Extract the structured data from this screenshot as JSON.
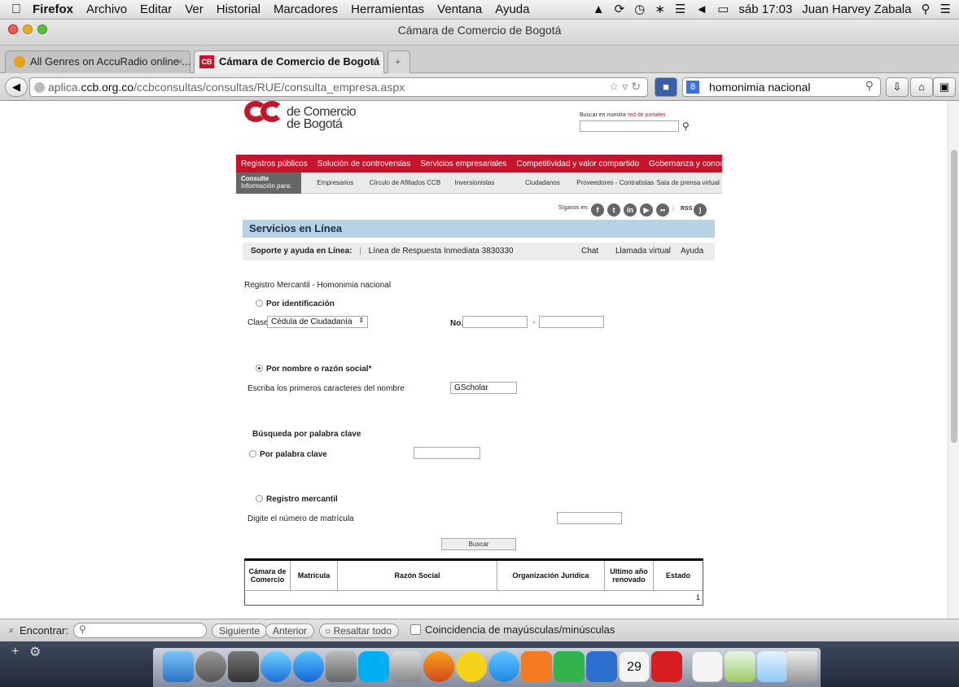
{
  "menubar": {
    "app": "Firefox",
    "items": [
      "Archivo",
      "Editar",
      "Ver",
      "Historial",
      "Marcadores",
      "Herramientas",
      "Ventana",
      "Ayuda"
    ],
    "clock": "sáb 17:03",
    "user": "Juan Harvey Zabala"
  },
  "window": {
    "title": "Cámara de Comercio de Bogotá"
  },
  "tabs": [
    {
      "label": "All Genres on AccuRadio online ...",
      "active": false
    },
    {
      "label": "Cámara de Comercio de Bogotá",
      "active": true
    }
  ],
  "navbar": {
    "url_prefix": "aplica.",
    "url_domain": "ccb.org.co",
    "url_path": "/ccbconsultas/consultas/RUE/consulta_empresa.aspx",
    "search_value": "homonimia nacional"
  },
  "site": {
    "logo": {
      "line1": "de Comercio",
      "line2": "de Bogotá"
    },
    "portal_search": {
      "prefix": "Buscar en nuestra",
      "link": "red de portales"
    },
    "main_nav": [
      "Registros públicos",
      "Solución de controversias",
      "Servicios empresariales",
      "Competitividad y valor compartido",
      "Gobernanza y conocimiento empresarial"
    ],
    "sub_nav": {
      "consulte_title": "Consulte",
      "consulte_sub": "Información para:",
      "items": [
        "Empresarios",
        "Círculo de Afiliados CCB",
        "Inversionistas",
        "Ciudadanos",
        "Proveedores - Contratistas",
        "Sala de prensa virtual"
      ]
    },
    "siganos": "Síganos en:",
    "rss": "RSS"
  },
  "services": {
    "title": "Servicios en Línea",
    "support_label": "Soporte y ayuda en Línea:",
    "line": "Línea de Respuesta Inmediata 3830330",
    "links": [
      "Chat",
      "Llamada virtual",
      "Ayuda"
    ]
  },
  "form": {
    "heading": "Registro Mercantil - Homonimia nacional",
    "por_identificacion": "Por identificación",
    "clase_label": "Clase:",
    "clase_value": "Cédula de Ciudadanía",
    "no_label": "No.",
    "dash": "-",
    "por_nombre": "Por nombre o razón social*",
    "nombre_label": "Escriba los primeros caracteres del nombre",
    "nombre_value": "GScholar",
    "busqueda_title": "Búsqueda por palabra clave",
    "por_palabra": "Por palabra clave",
    "registro_mercantil": "Registro mercantil",
    "matricula_label": "Digite el número de matrícula",
    "buscar": "Buscar"
  },
  "results": {
    "headers": [
      "Cámara de Comercio",
      "Matrícula",
      "Razón Social",
      "Organización Jurídica",
      "Ultimo año renovado",
      "Estado"
    ],
    "page": "1"
  },
  "findbar": {
    "label": "Encontrar:",
    "next": "Siguiente",
    "prev": "Anterior",
    "highlight": "Resaltar todo",
    "match_case": "Coincidencia de mayúsculas/minúsculas"
  },
  "dock": {
    "calendar_day": "29"
  },
  "colors": {
    "brand_red": "#c4152c",
    "services_blue": "#b6d2e4"
  }
}
